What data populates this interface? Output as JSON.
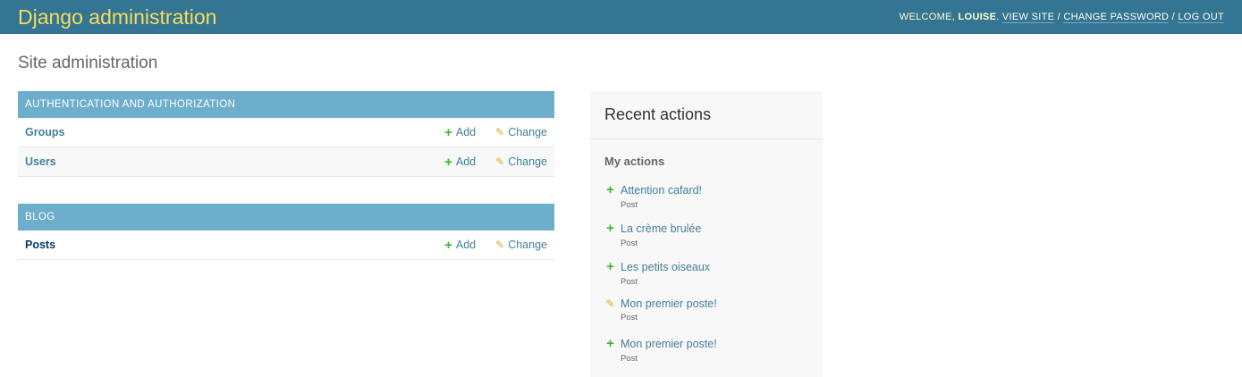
{
  "header": {
    "title": "Django administration",
    "welcome": "Welcome,",
    "user": "Louise",
    "view_site": "View site",
    "change_password": "Change password",
    "log_out": "Log out",
    "sep": "/"
  },
  "page_title": "Site administration",
  "modules": [
    {
      "caption": "Authentication and Authorization",
      "rows": [
        {
          "name": "Groups",
          "add": "Add",
          "change": "Change"
        },
        {
          "name": "Users",
          "add": "Add",
          "change": "Change"
        }
      ]
    },
    {
      "caption": "Blog",
      "rows": [
        {
          "name": "Posts",
          "add": "Add",
          "change": "Change"
        }
      ]
    }
  ],
  "recent": {
    "title": "Recent actions",
    "subtitle": "My actions",
    "items": [
      {
        "title": "Attention cafard!",
        "type": "Post",
        "icon": "plus-icon"
      },
      {
        "title": "La crème brulée",
        "type": "Post",
        "icon": "plus-icon"
      },
      {
        "title": "Les petits oiseaux",
        "type": "Post",
        "icon": "plus-icon"
      },
      {
        "title": "Mon premier poste!",
        "type": "Post",
        "icon": "pencil-icon"
      },
      {
        "title": "Mon premier poste!",
        "type": "Post",
        "icon": "plus-icon"
      }
    ]
  },
  "colors": {
    "header": "#337592",
    "brand": "#f5dd5d",
    "caption": "#6eaecd",
    "link": "#447e9b",
    "add": "#3cb62e",
    "change": "#eaa92a"
  }
}
